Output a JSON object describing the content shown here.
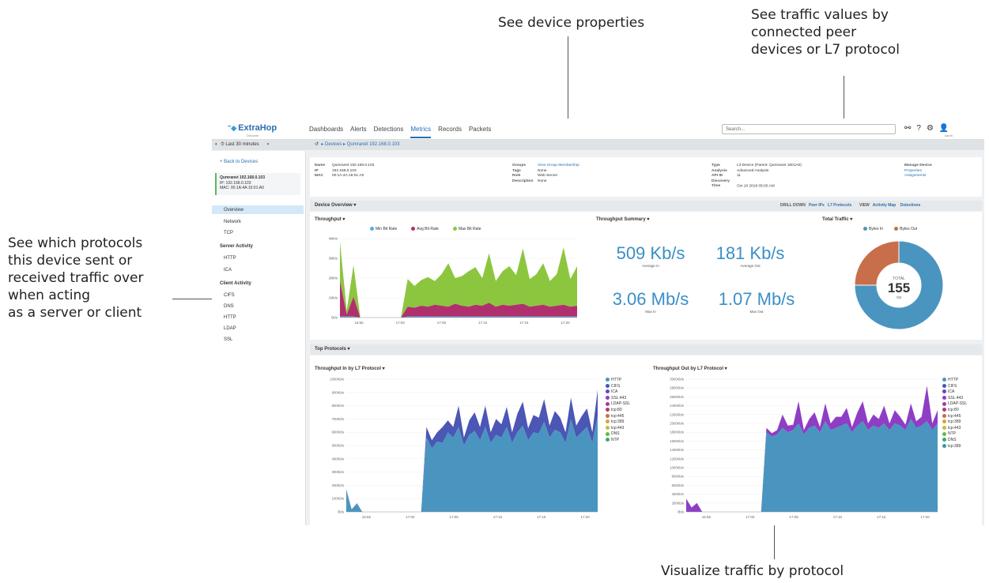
{
  "callouts": {
    "device_properties": "See device properties",
    "traffic_values": [
      "See traffic values by",
      "connected peer",
      "devices or L7 protocol"
    ],
    "protocols": [
      "See which protocols",
      "this device sent or",
      "received traffic over",
      "when acting",
      "as a server or client"
    ],
    "visualize": "Visualize traffic by protocol"
  },
  "app": {
    "logo": "ExtraHop",
    "logo_sub": "Discover",
    "nav": [
      "Dashboards",
      "Alerts",
      "Detections",
      "Metrics",
      "Records",
      "Packets"
    ],
    "nav_active": "Metrics",
    "search_placeholder": "Search...",
    "user": "sarah",
    "time_range": "Last 30 minutes",
    "breadcrumb": [
      "Devices",
      "Qumranet 192.168.0.103"
    ]
  },
  "sidebar": {
    "back": "Back to Devices",
    "device_name": "Qumranet 192.168.0.103",
    "device_ip": "IP: 192.168.0.103",
    "device_mac": "MAC: 00:1A:4A:16:01:A0",
    "items": [
      "Overview",
      "Network",
      "TCP"
    ],
    "selected": "Overview",
    "server_heading": "Server Activity",
    "server_items": [
      "HTTP",
      "ICA"
    ],
    "client_heading": "Client Activity",
    "client_items": [
      "CIFS",
      "DNS",
      "HTTP",
      "LDAP",
      "SSL"
    ]
  },
  "properties": {
    "col1": [
      [
        "Name",
        "Qumranet 192.168.0.103"
      ],
      [
        "IP",
        "192.168.0.103"
      ],
      [
        "MAC",
        "00:1A:4A:16:01:A0"
      ]
    ],
    "col2": [
      [
        "Groups",
        "View Group Membership"
      ],
      [
        "Tags",
        "None"
      ],
      [
        "Role",
        "Web Server"
      ],
      [
        "Description",
        "None"
      ]
    ],
    "col3": [
      [
        "Type",
        "L3 Device (Parent: Qumranet 1601A0)"
      ],
      [
        "Analysis",
        "Advanced Analysis"
      ],
      [
        "API ID",
        "11"
      ],
      [
        "Discovery Time",
        "Oct 10 2018 05:00 AM"
      ]
    ],
    "col4": [
      "Manage Device",
      "Properties",
      "Assignments"
    ]
  },
  "overview": {
    "tab": "Device Overview",
    "drill_label": "DRILL DOWN",
    "drill_peer": "Peer IPs",
    "drill_l7": "L7 Protocols",
    "view_label": "VIEW",
    "view_activity": "Activity Map",
    "view_detections": "Detections",
    "throughput_title": "Throughput",
    "summary_title": "Throughput Summary",
    "total_title": "Total Traffic",
    "avg_in": "509 Kb/s",
    "avg_in_label": "Average In",
    "avg_out": "181 Kb/s",
    "avg_out_label": "Average Out",
    "max_in": "3.06 Mb/s",
    "max_in_label": "Max In",
    "max_out": "1.07 Mb/s",
    "max_out_label": "Max Out",
    "donut_total_label": "TOTAL",
    "donut_total": "155",
    "donut_unit": "GB"
  },
  "protocols": {
    "tab": "Top Protocols",
    "in_title": "Throughput In by L7 Protocol",
    "out_title": "Throughput Out by L7 Protocol"
  },
  "colors": {
    "accent": "#2a6fb0",
    "http": "#4a95bf",
    "cifs": "#4b56b5",
    "ica": "#5c4bc4",
    "ssl": "#8e3ec4",
    "min": "#5aaae0",
    "avg": "#b0306e",
    "max": "#8cc63e",
    "bytes_in": "#4a95bf",
    "bytes_out": "#c86e4a"
  },
  "chart_data": [
    {
      "type": "area",
      "title": "Throughput",
      "series": [
        {
          "name": "Min Bit Rate",
          "values": [
            0.05,
            0.05,
            0.05,
            0,
            0,
            0,
            0,
            0,
            0,
            0,
            0.05,
            0.05,
            0.05,
            0.05,
            0.05,
            0.05,
            0.05,
            0.05,
            0.05,
            0.05,
            0.05,
            0.05,
            0.05,
            0.05,
            0.05,
            0.05,
            0.05,
            0.05,
            0.05,
            0.05,
            0.05,
            0.05,
            0.05,
            0.05,
            0.05,
            0.05
          ]
        },
        {
          "name": "Avg Bit Rate",
          "values": [
            1.8,
            0.1,
            1.0,
            0,
            0,
            0,
            0,
            0,
            0,
            0,
            0.5,
            0.45,
            0.55,
            0.5,
            0.6,
            0.55,
            0.5,
            0.65,
            0.55,
            0.5,
            0.6,
            0.55,
            0.7,
            0.5,
            0.6,
            0.55,
            0.6,
            0.65,
            0.5,
            0.55,
            0.6,
            0.5,
            0.55,
            0.6,
            0.5,
            0.55
          ]
        },
        {
          "name": "Max Bit Rate",
          "values": [
            2.0,
            0.2,
            1.6,
            0,
            0,
            0,
            0,
            0,
            0,
            0,
            1.4,
            1.1,
            1.3,
            1.5,
            1.2,
            1.6,
            2.2,
            1.3,
            1.5,
            1.8,
            1.9,
            1.4,
            2.5,
            1.3,
            1.7,
            2.0,
            1.5,
            2.8,
            1.4,
            1.6,
            2.1,
            1.3,
            1.6,
            2.9,
            1.4,
            2.0
          ]
        }
      ],
      "x_ticks": [
        "16:55",
        "17:00",
        "17:05",
        "17:10",
        "17:15",
        "17:20"
      ],
      "y_ticks": [
        "0b/s",
        "1Mb/s",
        "2Mb/s",
        "3Mb/s",
        "4Mb/s"
      ],
      "ylim": [
        0,
        4
      ]
    },
    {
      "type": "pie",
      "title": "Total Traffic",
      "categories": [
        "Bytes In",
        "Bytes Out"
      ],
      "values": [
        75,
        25
      ]
    },
    {
      "type": "area",
      "title": "Throughput In by L7 Protocol",
      "legend": [
        "HTTP",
        "CIFS",
        "ICA",
        "SSL:443",
        "LDAP-SSL",
        "tcp:80",
        "tcp:445",
        "tcp:389",
        "tcp:443",
        "DNS",
        "NTP"
      ],
      "series": [
        {
          "name": "HTTP",
          "values": [
            160,
            20,
            60,
            0,
            0,
            0,
            0,
            0,
            0,
            0,
            0,
            0,
            0,
            0,
            0,
            560,
            480,
            530,
            520,
            600,
            560,
            640,
            500,
            580,
            610,
            540,
            640,
            520,
            580,
            560,
            640,
            520,
            600,
            650,
            540,
            600,
            590,
            680,
            560,
            620,
            600,
            520,
            700,
            560,
            600,
            640,
            520,
            720
          ]
        },
        {
          "name": "CIFS",
          "values": [
            10,
            0,
            5,
            0,
            0,
            0,
            0,
            0,
            0,
            0,
            0,
            0,
            0,
            0,
            0,
            80,
            60,
            70,
            120,
            90,
            80,
            160,
            60,
            110,
            140,
            100,
            160,
            80,
            120,
            100,
            150,
            80,
            140,
            180,
            90,
            130,
            120,
            170,
            90,
            140,
            110,
            80,
            160,
            90,
            120,
            140,
            80,
            200
          ]
        }
      ],
      "x_ticks": [
        "16:55",
        "17:00",
        "17:05",
        "17:10",
        "17:15",
        "17:20"
      ],
      "y_ticks": [
        "0b/s",
        "100Kb/s",
        "200Kb/s",
        "300Kb/s",
        "400Kb/s",
        "500Kb/s",
        "600Kb/s",
        "700Kb/s",
        "800Kb/s",
        "900Kb/s",
        "1000Kb/s"
      ],
      "ylim": [
        0,
        1000
      ]
    },
    {
      "type": "area",
      "title": "Throughput Out by L7 Protocol",
      "legend": [
        "HTTP",
        "CIFS",
        "ICA",
        "SSL:443",
        "LDAP-SSL",
        "tcp:80",
        "tcp:445",
        "tcp:389",
        "tcp:443",
        "NTP",
        "DNS",
        "tcp:389"
      ],
      "series": [
        {
          "name": "HTTP",
          "values": [
            0,
            0,
            0,
            0,
            0,
            0,
            0,
            0,
            0,
            0,
            0,
            0,
            0,
            0,
            0,
            1800,
            1700,
            1750,
            1900,
            1800,
            1850,
            2000,
            1750,
            1900,
            1950,
            1800,
            2050,
            1850,
            1900,
            1950,
            2000,
            1800,
            1950,
            2050,
            1850,
            1950,
            1900,
            2000,
            1850,
            2000,
            1950,
            1850,
            2100,
            1900,
            1950,
            2050,
            1850,
            2000
          ]
        },
        {
          "name": "SSL:443",
          "values": [
            300,
            100,
            200,
            0,
            0,
            0,
            0,
            0,
            0,
            0,
            0,
            0,
            0,
            0,
            0,
            100,
            80,
            100,
            300,
            150,
            120,
            500,
            100,
            200,
            300,
            120,
            400,
            150,
            250,
            200,
            350,
            120,
            300,
            450,
            150,
            250,
            200,
            400,
            150,
            300,
            200,
            120,
            350,
            150,
            200,
            800,
            150,
            300
          ]
        }
      ],
      "x_ticks": [
        "16:55",
        "17:00",
        "17:05",
        "17:10",
        "17:15",
        "17:20"
      ],
      "y_ticks": [
        "0b/s",
        "200Kb/s",
        "400Kb/s",
        "600Kb/s",
        "800Kb/s",
        "1000Kb/s",
        "1200Kb/s",
        "1400Kb/s",
        "1600Kb/s",
        "1800Kb/s",
        "2000Kb/s",
        "2200Kb/s",
        "2400Kb/s",
        "2600Kb/s",
        "2800Kb/s",
        "3000Kb/s"
      ],
      "ylim": [
        0,
        3000
      ]
    }
  ]
}
